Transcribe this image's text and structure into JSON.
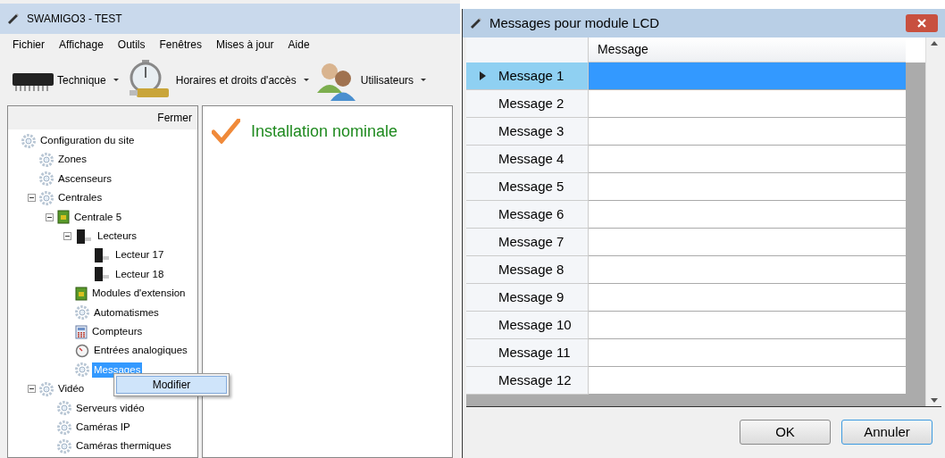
{
  "main_window": {
    "title": "SWAMIGO3 - TEST",
    "menu": [
      "Fichier",
      "Affichage",
      "Outils",
      "Fenêtres",
      "Mises à jour",
      "Aide"
    ],
    "toolbar": [
      {
        "kind": "chip",
        "label": "Technique"
      },
      {
        "kind": "stopwatch",
        "label": "Horaires et droits d'accès"
      },
      {
        "kind": "users",
        "label": "Utilisateurs"
      }
    ],
    "tree_panel": {
      "close_label": "Fermer",
      "tree": [
        {
          "label": "Configuration du site",
          "kind": "gear",
          "selected": false,
          "children": [
            {
              "label": "Zones",
              "kind": "gear",
              "selected": false
            },
            {
              "label": "Ascenseurs",
              "kind": "gear",
              "selected": false
            },
            {
              "label": "Centrales",
              "kind": "gear",
              "selected": false,
              "expanded": true,
              "children": [
                {
                  "label": "Centrale 5",
                  "kind": "board",
                  "selected": false,
                  "expanded": true,
                  "children": [
                    {
                      "label": "Lecteurs",
                      "kind": "reader",
                      "selected": false,
                      "expanded": true,
                      "children": [
                        {
                          "label": "Lecteur 17",
                          "kind": "reader",
                          "selected": false
                        },
                        {
                          "label": "Lecteur 18",
                          "kind": "reader",
                          "selected": false
                        }
                      ]
                    },
                    {
                      "label": "Modules d'extension",
                      "kind": "board",
                      "selected": false
                    },
                    {
                      "label": "Automatismes",
                      "kind": "gear",
                      "selected": false
                    },
                    {
                      "label": "Compteurs",
                      "kind": "calculator",
                      "selected": false
                    },
                    {
                      "label": "Entrées analogiques",
                      "kind": "gauge",
                      "selected": false
                    },
                    {
                      "label": "Messages",
                      "kind": "gear",
                      "selected": true
                    }
                  ]
                }
              ]
            },
            {
              "label": "Vidéo",
              "kind": "gear",
              "selected": false,
              "expanded": true,
              "children": [
                {
                  "label": "Serveurs vidéo",
                  "kind": "gear",
                  "selected": false
                },
                {
                  "label": "Caméras IP",
                  "kind": "gear",
                  "selected": false
                },
                {
                  "label": "Caméras thermiques",
                  "kind": "gear",
                  "selected": false
                }
              ]
            }
          ]
        }
      ]
    },
    "context_menu": [
      "Modifier"
    ],
    "status": {
      "text": "Installation nominale"
    }
  },
  "dialog": {
    "title": "Messages pour module LCD",
    "column": "Message",
    "rows": [
      {
        "label": "Message 1",
        "selected": true
      },
      {
        "label": "Message 2",
        "selected": false
      },
      {
        "label": "Message 3",
        "selected": false
      },
      {
        "label": "Message 4",
        "selected": false
      },
      {
        "label": "Message 5",
        "selected": false
      },
      {
        "label": "Message 6",
        "selected": false
      },
      {
        "label": "Message 7",
        "selected": false
      },
      {
        "label": "Message 8",
        "selected": false
      },
      {
        "label": "Message 9",
        "selected": false
      },
      {
        "label": "Message 10",
        "selected": false
      },
      {
        "label": "Message 11",
        "selected": false
      },
      {
        "label": "Message 12",
        "selected": false
      }
    ],
    "buttons": [
      "OK",
      "Annuler"
    ]
  }
}
